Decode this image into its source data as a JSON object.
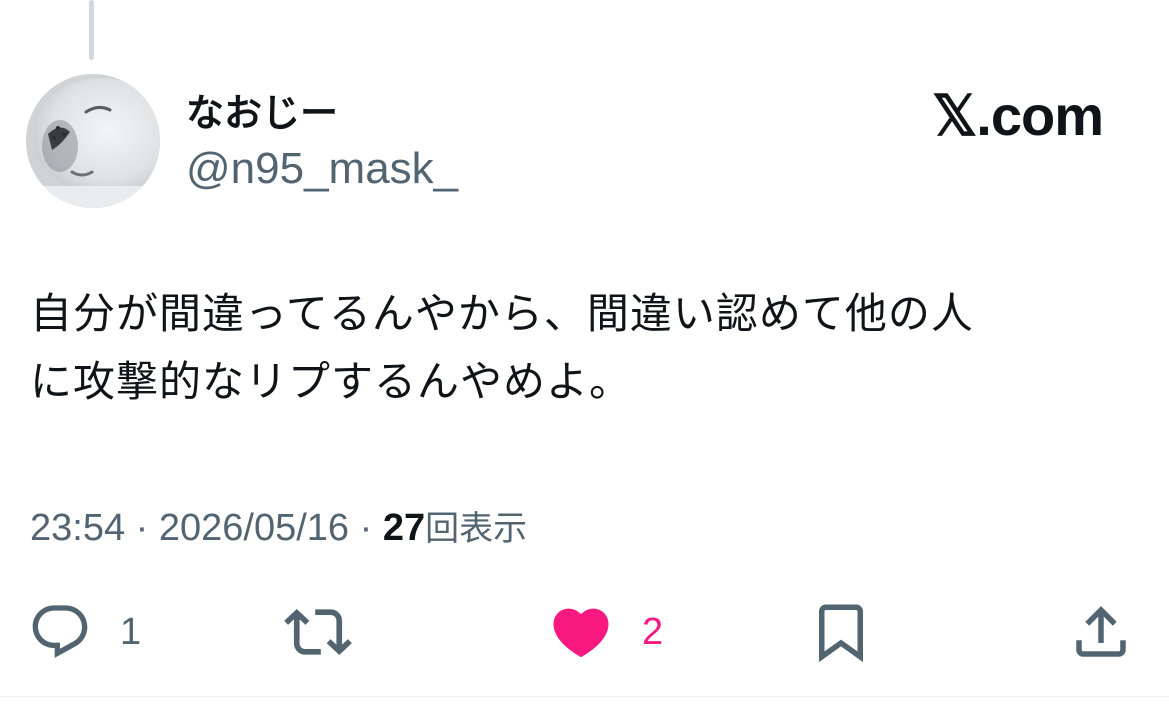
{
  "post": {
    "author": {
      "display_name": "なおじー",
      "handle": "@n95_mask_"
    },
    "brand": "𝕏.com",
    "text_lines": [
      "自分が間違ってるんやから、間違い認めて他の人",
      "に攻撃的なリプするんやめよ。"
    ],
    "time": "23:54",
    "date": "2026/05/16",
    "separator": "·",
    "views_count": "27",
    "views_label": "回表示"
  },
  "actions": {
    "reply_count": "1",
    "like_count": "2"
  },
  "icons": [
    "reply-icon",
    "repost-icon",
    "like-icon",
    "bookmark-icon",
    "share-icon"
  ],
  "colors": {
    "text_primary": "#0f1419",
    "text_secondary": "#536471",
    "like": "#f91880"
  }
}
